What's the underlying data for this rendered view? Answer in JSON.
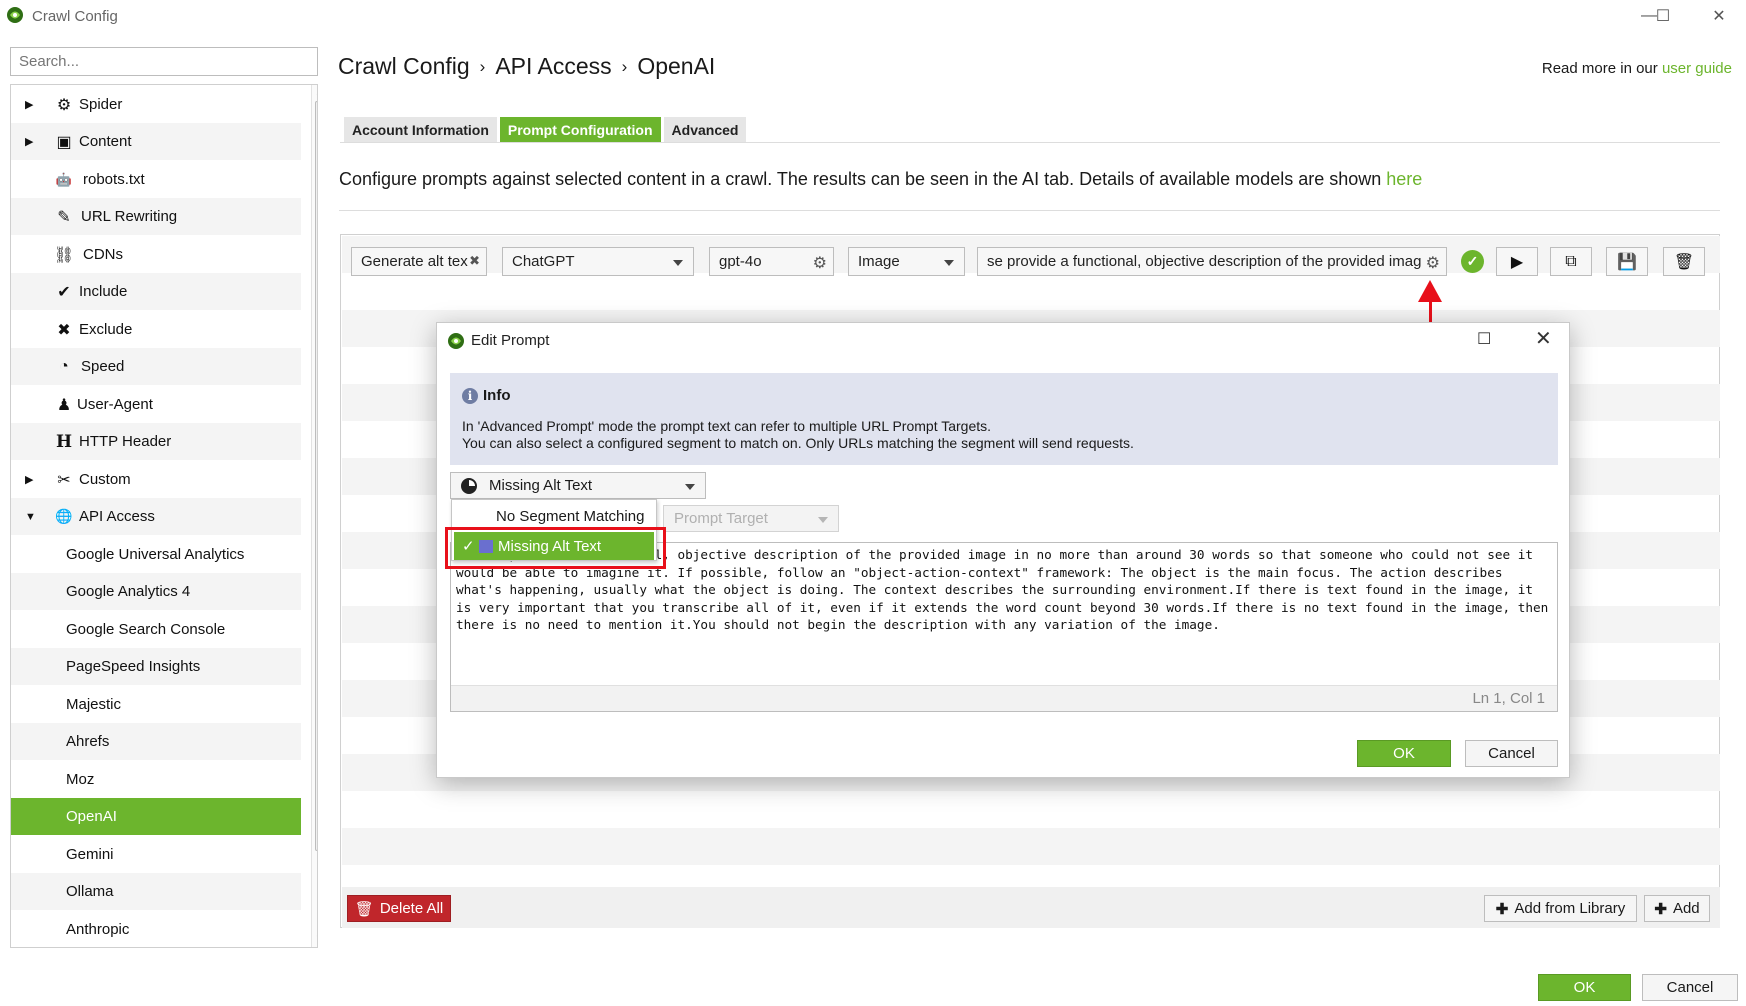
{
  "window": {
    "title": "Crawl Config",
    "minimize_glyph": "—",
    "maximize_glyph": "☐",
    "close_glyph": "✕"
  },
  "search": {
    "placeholder": "Search..."
  },
  "sidebar": {
    "items": [
      {
        "label": "Spider",
        "icon": "gear-icon",
        "glyph": "⚙",
        "expandable": true
      },
      {
        "label": "Content",
        "icon": "layout-icon",
        "glyph": "▣",
        "expandable": true
      },
      {
        "label": "robots.txt",
        "icon": "robot-icon",
        "glyph": "🤖",
        "expandable": false
      },
      {
        "label": "URL Rewriting",
        "icon": "edit-icon",
        "glyph": "✎",
        "expandable": false
      },
      {
        "label": "CDNs",
        "icon": "network-icon",
        "glyph": "⛓",
        "expandable": false
      },
      {
        "label": "Include",
        "icon": "check-circle-icon",
        "glyph": "✔",
        "expandable": false
      },
      {
        "label": "Exclude",
        "icon": "cross-circle-icon",
        "glyph": "✖",
        "expandable": false
      },
      {
        "label": "Speed",
        "icon": "speedometer-icon",
        "glyph": "◔",
        "expandable": false
      },
      {
        "label": "User-Agent",
        "icon": "user-icon",
        "glyph": "♟",
        "expandable": false
      },
      {
        "label": "HTTP Header",
        "icon": "header-icon",
        "glyph": "H",
        "expandable": false
      },
      {
        "label": "Custom",
        "icon": "tools-icon",
        "glyph": "✂",
        "expandable": true
      },
      {
        "label": "API Access",
        "icon": "globe-icon",
        "glyph": "🌐",
        "expandable": true,
        "expanded": true
      }
    ],
    "children": [
      "Google Universal Analytics",
      "Google Analytics 4",
      "Google Search Console",
      "PageSpeed Insights",
      "Majestic",
      "Ahrefs",
      "Moz",
      "OpenAI",
      "Gemini",
      "Ollama",
      "Anthropic"
    ],
    "selected": "OpenAI"
  },
  "breadcrumb": [
    "Crawl Config",
    "API Access",
    "OpenAI"
  ],
  "readmore": {
    "prefix": "Read more in our ",
    "link": "user guide"
  },
  "tabs": [
    "Account Information",
    "Prompt Configuration",
    "Advanced"
  ],
  "active_tab": "Prompt Configuration",
  "description": {
    "text": "Configure prompts against selected content in a crawl. The results can be seen in the AI tab. Details of available models are shown ",
    "link": "here"
  },
  "prompt_row": {
    "name": "Generate alt tex",
    "provider": "ChatGPT",
    "model": "gpt-4o",
    "content_type": "Image",
    "prompt_preview": "se provide a functional, objective description of the provided imag"
  },
  "buttons": {
    "delete_all": "Delete All",
    "add_from_library": "Add from Library",
    "add": "Add",
    "ok": "OK",
    "cancel": "Cancel"
  },
  "dialog": {
    "title": "Edit Prompt",
    "info_heading": "Info",
    "info_line1": "In 'Advanced Prompt' mode the prompt text can refer to multiple URL Prompt Targets.",
    "info_line2": "You can also select a configured segment to match on. Only URLs matching the segment will send requests.",
    "segment_selected": "Missing Alt Text",
    "target_placeholder": "Prompt Target",
    "segment_options": [
      "No Segment Matching",
      "Missing Alt Text"
    ],
    "prompt_text": "Please provide a functional, objective description of the provided image in no more than around 30 words so that someone who could not see it would be able to imagine it. If possible, follow an \"object-action-context\" framework: The object is the main focus. The action describes what's happening, usually what the object is doing. The context describes the surrounding environment.If there is text found in the image, it is very important that you transcribe all of it, even if it extends the word count beyond 30 words.If there is no text found in the image, then there is no need to mention it.You should not begin the description with any variation of the image.",
    "cursor_position": "Ln 1, Col 1",
    "ok": "OK",
    "cancel": "Cancel"
  },
  "colors": {
    "accent_green": "#6cb52d",
    "delete_red": "#c0262b",
    "annotation_red": "#e8101a",
    "segment_swatch": "#6a6fcf",
    "info_bg": "#e0e3ef"
  }
}
